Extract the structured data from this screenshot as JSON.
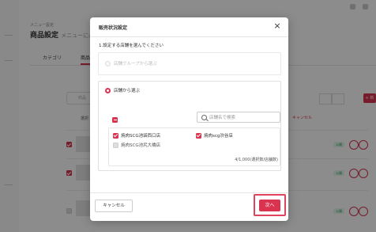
{
  "background": {
    "breadcrumb": "メニュー設定",
    "page_title": "商品設定",
    "page_subtitle": "メニューに必要",
    "tabs": [
      "カテゴリ",
      "商品"
    ],
    "search_placeholder": "商品",
    "column_header": "選択",
    "red_header": "キャンセル",
    "new_button": "+ 新",
    "status_badge": "公開"
  },
  "modal": {
    "title": "販売状況設定",
    "close_icon": "close-icon",
    "question": "1.設定する店舗を選んでください",
    "option_group_label": "店舗グループから選ぶ",
    "option_store_label": "店舗から選ぶ",
    "search_placeholder": "店舗名で検索",
    "stores": [
      {
        "name": "焼肉SCG池袋西口店",
        "checked": true
      },
      {
        "name": "焼肉scg渋谷店",
        "checked": true
      },
      {
        "name": "焼肉SCG池尻大橋店",
        "checked": false
      }
    ],
    "count_text": "4/1,000(選択数/店舗数)",
    "cancel_label": "キャンセル",
    "next_label": "次へ"
  },
  "colors": {
    "accent": "#d9334f",
    "overlay": "rgba(0,0,0,0.45)"
  }
}
